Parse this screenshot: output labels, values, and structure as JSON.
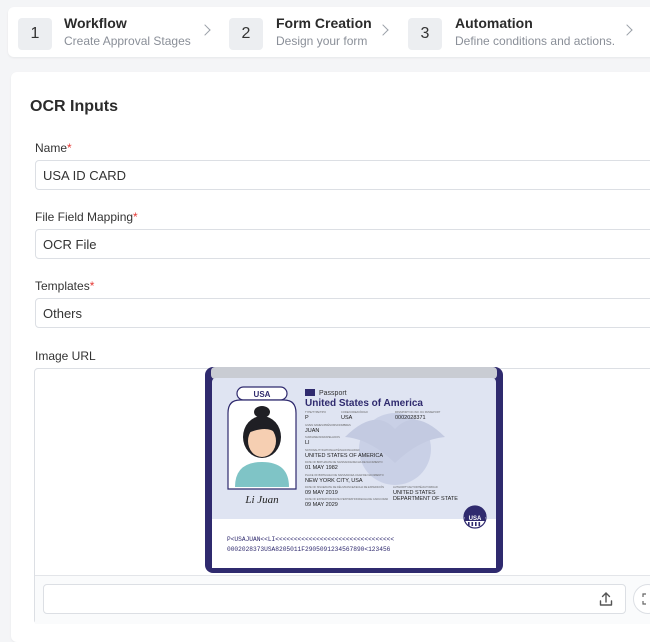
{
  "stepper": {
    "steps": [
      {
        "number": "1",
        "title": "Workflow",
        "subtitle": "Create Approval Stages"
      },
      {
        "number": "2",
        "title": "Form Creation",
        "subtitle": "Design your form"
      },
      {
        "number": "3",
        "title": "Automation",
        "subtitle": "Define conditions and actions."
      }
    ]
  },
  "card": {
    "title": "OCR Inputs",
    "name_label": "Name",
    "name_value": "USA ID CARD",
    "mapping_label": "File Field Mapping",
    "mapping_value": "OCR File",
    "templates_label": "Templates",
    "templates_value": "Others",
    "image_url_label": "Image URL",
    "required_mark": "*"
  },
  "passport": {
    "badge": "USA",
    "doc_type": "Passport",
    "country": "United States of America",
    "type_label": "TYPE/TYPE/TIPO",
    "type_value": "P",
    "code_label": "CODE/CODE/CÓDIGO",
    "code_value": "USA",
    "passport_no_label": "PASSPORT NO./NO. DU PASSEPORT",
    "passport_no_value": "0002028371",
    "given_label": "GIVEN NAMES/PRÉNOMS/NOMBRES",
    "given_value": "JUAN",
    "surname_label": "SURNAME/NOM/APELLIDOS",
    "surname_value": "LI",
    "nationality_label": "NATIONALITY/NATIONALITÉ/NACIONALIDAD",
    "nationality_value": "UNITED STATES OF AMERICA",
    "dob_label": "DATE OF BIRTH/DATE DE NAISSANCE/FECHA DE NACIMIENTO",
    "dob_value": "01 MAY 1982",
    "pob_label": "PLACE OF BIRTH/LIEU DE NAISSANCE/LUGAR DE NACIMIENTO",
    "pob_value": "NEW YORK CITY, USA",
    "issue_label": "DATE OF ISSUE/DATE DE DÉLIVRANCE/FECHA DE EXPEDICIÓN",
    "issue_value": "09 MAY 2019",
    "expiry_label": "DATE OF EXPIRATION/DATE D'EXPIRATION/FECHA DE CADUCIDAD",
    "expiry_value": "09 MAY 2029",
    "authority_label": "AUTHORITY/AUTORITÉ/AUTORIDAD",
    "authority_value_1": "UNITED STATES",
    "authority_value_2": "DEPARTMENT OF STATE",
    "signature": "Li Juan",
    "chip_badge": "USA",
    "mrz_line_1": "P<USAJUAN<<LI<<<<<<<<<<<<<<<<<<<<<<<<<<<<<<<<",
    "mrz_line_2": "0002028373USA8205011F2905091234567890<123456"
  },
  "image_url": {
    "value": "",
    "upload_icon": "upload-icon",
    "expand_icon": "expand-icon"
  },
  "colors": {
    "accent_navy": "#2f2a6e",
    "passport_bg": "#dfe4f2",
    "required": "#e53935"
  }
}
